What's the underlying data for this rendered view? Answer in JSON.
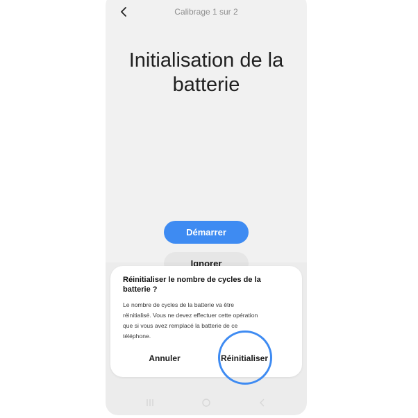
{
  "header": {
    "step": "Calibrage 1 sur 2"
  },
  "main": {
    "title_line1": "Initialisation de la",
    "title_line2": "batterie",
    "start_button": "Démarrer",
    "ignore_button": "Ignorer"
  },
  "dialog": {
    "title_line1": "Réinitialiser le nombre de cycles de la",
    "title_line2": "batterie ?",
    "body_lines": [
      "Le nombre de cycles de la batterie va être",
      "réinitialisé. Vous ne devez effectuer cette opération",
      "que si vous avez remplacé la batterie de ce",
      "téléphone."
    ],
    "cancel_label": "Annuler",
    "reset_label": "Réinitialiser"
  },
  "nav": {
    "recent_icon": "recent-apps-icon",
    "home_icon": "home-icon",
    "back_icon": "back-icon"
  },
  "colors": {
    "accent": "#3e8bf2",
    "screen_bg": "#f1f1f1",
    "dialog_bg": "#ffffff"
  }
}
